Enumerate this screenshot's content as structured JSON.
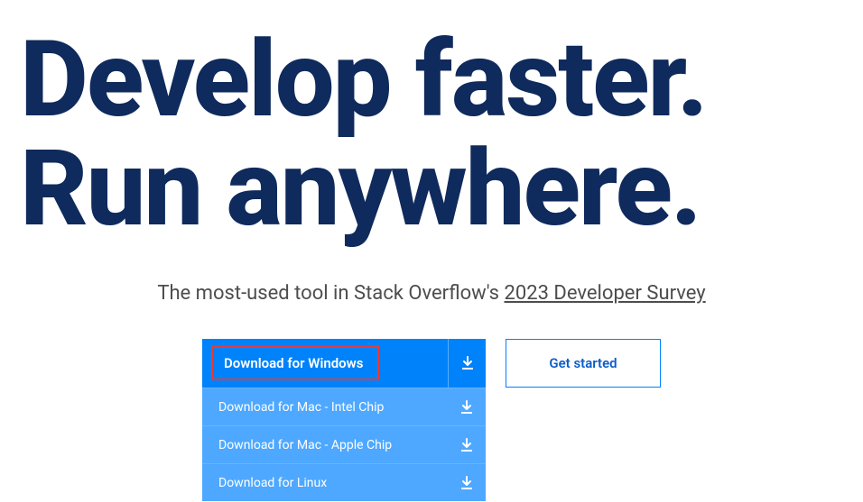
{
  "hero": {
    "line1": "Develop faster.",
    "line2": "Run anywhere."
  },
  "subtitle": {
    "prefix": "The most-used tool in Stack Overflow's ",
    "link": "2023 Developer Survey"
  },
  "downloads": {
    "primary": "Download for Windows",
    "options": [
      "Download for Mac - Intel Chip",
      "Download for Mac - Apple Chip",
      "Download for Linux"
    ]
  },
  "getStarted": "Get started"
}
